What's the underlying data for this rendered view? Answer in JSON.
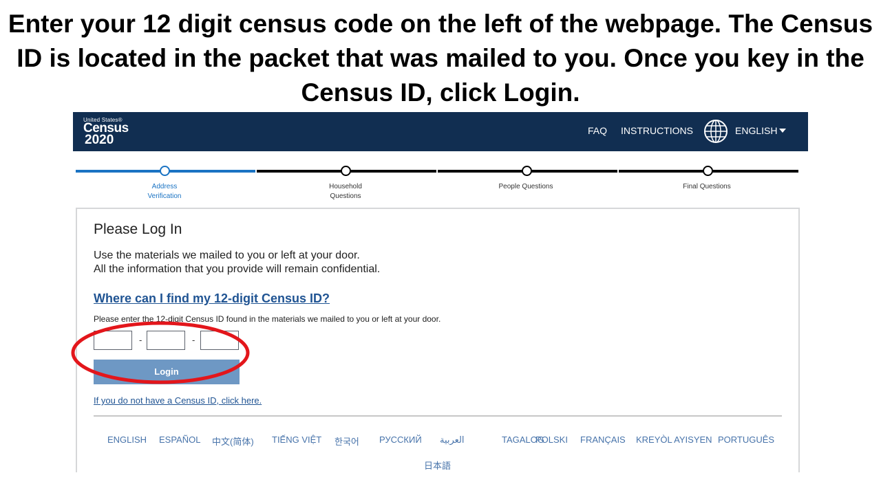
{
  "slide": {
    "instruction_lines": [
      "Enter your 12 digit census code on the left of the webpage.  The Census",
      "ID is located in the packet that was mailed to you.  Once you key in the",
      "Census ID,  click Login."
    ]
  },
  "header": {
    "logo_small": "United States®",
    "logo_big": "Census",
    "logo_year": "2020",
    "faq": "FAQ",
    "instructions": "INSTRUCTIONS",
    "language": "ENGLISH",
    "bg_color": "#112e51"
  },
  "progress": {
    "steps": [
      {
        "label_line1": "Address",
        "label_line2": "Verification",
        "active": true
      },
      {
        "label_line1": "Household",
        "label_line2": "Questions",
        "active": false
      },
      {
        "label_line1": "People Questions",
        "label_line2": "",
        "active": false
      },
      {
        "label_line1": "Final Questions",
        "label_line2": "",
        "active": false
      }
    ],
    "active_color": "#1a73c3",
    "inactive_color": "#000000"
  },
  "login": {
    "title": "Please Log In",
    "line1": "Use the materials we mailed to you or left at your door.",
    "line2": "All the information that you provide will remain confidential.",
    "help_link": "Where can I find my 12-digit Census ID?",
    "instruction": "Please enter the 12-digit Census ID found in the materials we mailed to you or left at your door.",
    "id_separator": "-",
    "button": "Login",
    "no_id_link": "If you do not have a Census ID, click here."
  },
  "languages": [
    "ENGLISH",
    "ESPAÑOL",
    "中文(简体)",
    "TIẾNG VIỆT",
    "한국어",
    "РУССКИЙ",
    "العربية",
    "TAGALOG",
    "POLSKI",
    "FRANÇAIS",
    "KREYÒL AYISYEN",
    "PORTUGUÊS",
    "日本語"
  ],
  "colors": {
    "link": "#205493",
    "button": "#6e98c4",
    "annotation": "#e3161b"
  }
}
